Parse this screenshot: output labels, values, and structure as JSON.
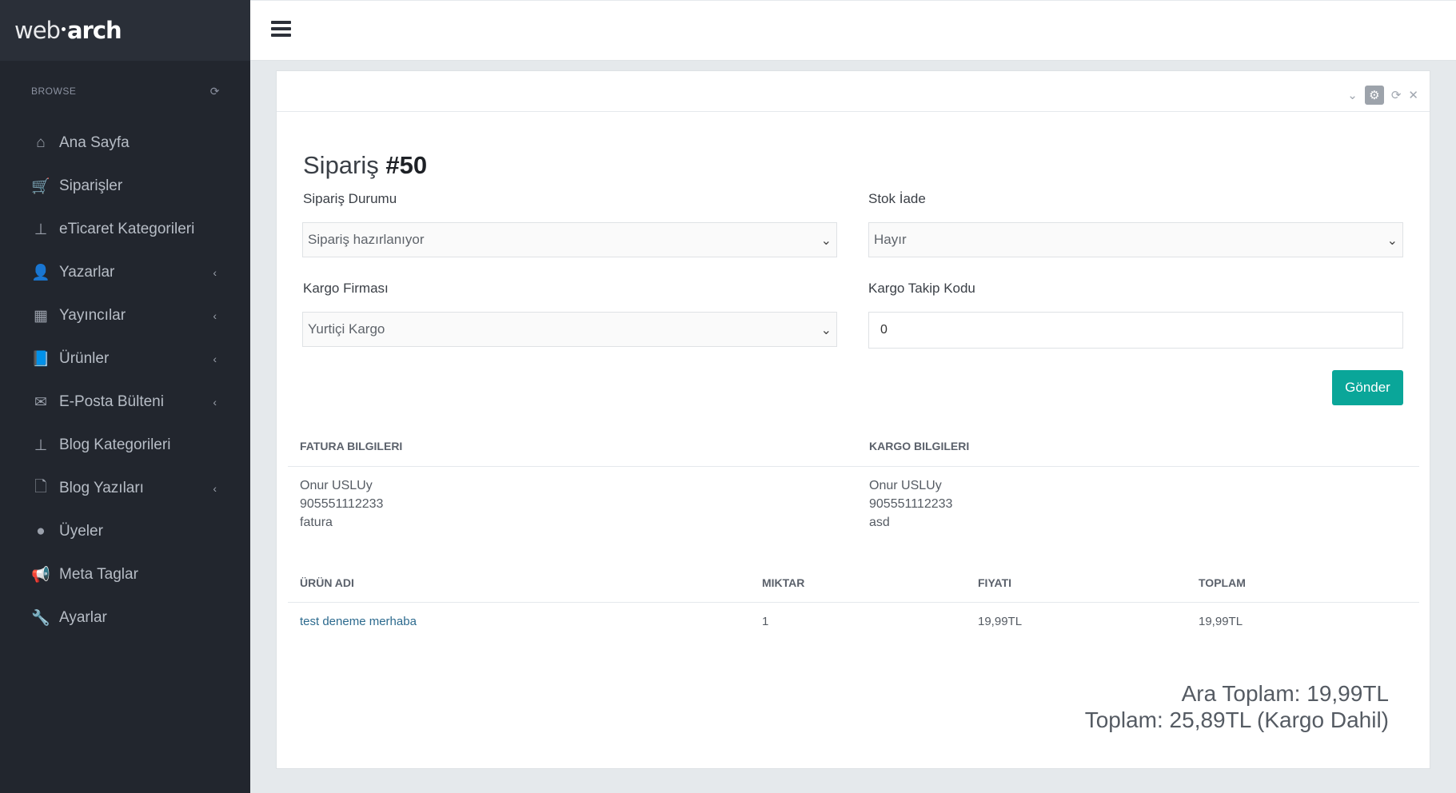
{
  "logo": {
    "part1": "web",
    "part2": "arch"
  },
  "sidebar": {
    "browse_label": "BROWSE",
    "items": [
      {
        "label": "Ana Sayfa",
        "icon": "home-icon",
        "glyph": "⌂",
        "arrow": ""
      },
      {
        "label": "Siparişler",
        "icon": "basket-icon",
        "glyph": "🛒",
        "arrow": ""
      },
      {
        "label": "eTicaret Kategorileri",
        "icon": "sitemap-icon",
        "glyph": "⊥",
        "arrow": ""
      },
      {
        "label": "Yazarlar",
        "icon": "user-icon",
        "glyph": "👤",
        "arrow": "‹"
      },
      {
        "label": "Yayıncılar",
        "icon": "building-icon",
        "glyph": "▦",
        "arrow": "‹"
      },
      {
        "label": "Ürünler",
        "icon": "book-icon",
        "glyph": "📘",
        "arrow": "‹"
      },
      {
        "label": "E-Posta Bülteni",
        "icon": "envelope-icon",
        "glyph": "✉",
        "arrow": "‹"
      },
      {
        "label": "Blog Kategorileri",
        "icon": "sitemap-icon",
        "glyph": "⊥",
        "arrow": ""
      },
      {
        "label": "Blog Yazıları",
        "icon": "file-icon",
        "glyph": "🗋",
        "arrow": "‹"
      },
      {
        "label": "Üyeler",
        "icon": "user-icon",
        "glyph": "●",
        "arrow": ""
      },
      {
        "label": "Meta Taglar",
        "icon": "bullhorn-icon",
        "glyph": "📢",
        "arrow": ""
      },
      {
        "label": "Ayarlar",
        "icon": "wrench-icon",
        "glyph": "🔧",
        "arrow": ""
      }
    ]
  },
  "order": {
    "title_prefix": "Sipariş",
    "title_number": "#50"
  },
  "form": {
    "status_label": "Sipariş Durumu",
    "status_value": "Sipariş hazırlanıyor",
    "stock_label": "Stok İade",
    "stock_value": "Hayır",
    "cargo_company_label": "Kargo Firması",
    "cargo_company_value": "Yurtiçi Kargo",
    "tracking_label": "Kargo Takip Kodu",
    "tracking_value": "0",
    "submit_label": "Gönder"
  },
  "billing": {
    "heading": "FATURA BILGILERI",
    "name": "Onur USLUy",
    "phone": "905551112233",
    "address": "fatura"
  },
  "shipping": {
    "heading": "KARGO BILGILERI",
    "name": "Onur USLUy",
    "phone": "905551112233",
    "address": "asd"
  },
  "products": {
    "headers": [
      "ÜRÜN ADI",
      "MIKTAR",
      "FIYATI",
      "TOPLAM"
    ],
    "rows": [
      {
        "name": "test deneme merhaba",
        "qty": "1",
        "price": "19,99TL",
        "total": "19,99TL"
      }
    ]
  },
  "totals": {
    "subtotal": "Ara Toplam: 19,99TL",
    "total": "Toplam: 25,89TL (Kargo Dahil)"
  },
  "colors": {
    "sidebar_bg": "#22262e",
    "accent": "#0aa699",
    "link": "#2c6a8e"
  }
}
